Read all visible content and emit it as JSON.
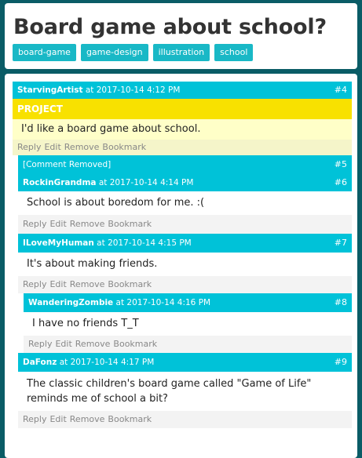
{
  "page": {
    "title": "Board game about school?"
  },
  "tags": [
    "board-game",
    "game-design",
    "illustration",
    "school"
  ],
  "actions": {
    "reply": "Reply",
    "edit": "Edit",
    "remove": "Remove",
    "bookmark": "Bookmark"
  },
  "posts": {
    "p4": {
      "author": "StarvingArtist",
      "at": " at 2017-10-14 4:12 PM",
      "num": "#4",
      "label": "PROJECT",
      "text": "I'd like a board game about school."
    },
    "p5": {
      "author": "[Comment Removed]",
      "num": "#5"
    },
    "p6": {
      "author": "RockinGrandma",
      "at": " at 2017-10-14 4:14 PM",
      "num": "#6",
      "text": "School is about boredom for me. :("
    },
    "p7": {
      "author": "ILoveMyHuman",
      "at": " at 2017-10-14 4:15 PM",
      "num": "#7",
      "text": "It's about making friends."
    },
    "p8": {
      "author": "WanderingZombie",
      "at": " at 2017-10-14 4:16 PM",
      "num": "#8",
      "text": "I have no friends T_T"
    },
    "p9": {
      "author": "DaFonz",
      "at": " at 2017-10-14 4:17 PM",
      "num": "#9",
      "text": "The classic children's board game called \"Game of Life\" reminds me of school a bit?"
    }
  },
  "colors": {
    "header": "#00c2d8",
    "tag": "#19b8c6",
    "project": "#f8e100",
    "background": "#0a5c66"
  }
}
